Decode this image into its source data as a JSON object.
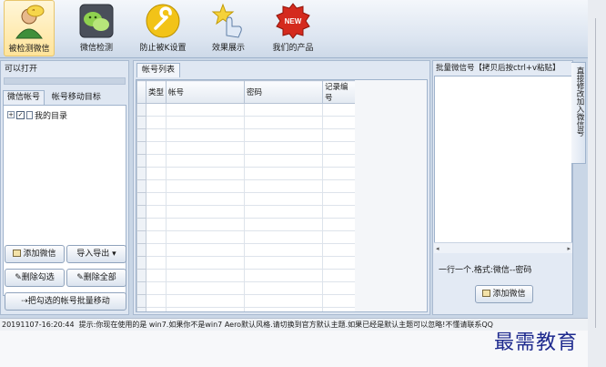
{
  "toolbar": {
    "items": [
      {
        "label": "被检测微信",
        "icon": "user-check-icon"
      },
      {
        "label": "微信检测",
        "icon": "wechat-icon"
      },
      {
        "label": "防止被K设置",
        "icon": "wrench-icon"
      },
      {
        "label": "效果展示",
        "icon": "hand-star-icon"
      },
      {
        "label": "我们的产品",
        "icon": "new-badge-icon"
      }
    ],
    "new_badge_text": "NEW"
  },
  "left": {
    "title": "可以打开",
    "tabs": [
      "微信帐号",
      "帐号移动目标"
    ],
    "tree_root": "我的目录",
    "buttons": {
      "add": "添加微信",
      "import_export": "导入导出",
      "delete_checked": "删除勾选",
      "delete_all": "删除全部",
      "move_batch": "把勾选的帐号批量移动"
    }
  },
  "center": {
    "tab": "帐号列表",
    "columns": [
      "类型",
      "帐号",
      "密码",
      "记录编号"
    ]
  },
  "right": {
    "batch_label": "批量微信号【拷贝后按ctrl+v粘贴】",
    "format_hint": "一行一个.格式:微信--密码",
    "add_button": "添加微信",
    "side_tab": "直接修改加入微信号"
  },
  "status": {
    "time": "20191107-16:20:44",
    "message": "提示:你现在使用的是 win7.如果你不是win7 Aero默认风格.请切换到官方默认主题.如果已经是默认主题可以忽略!不懂请联系QQ"
  },
  "watermark": "最需教育",
  "colors": {
    "accent": "#1e2a8e",
    "ribbon": "#dbe4f0"
  }
}
